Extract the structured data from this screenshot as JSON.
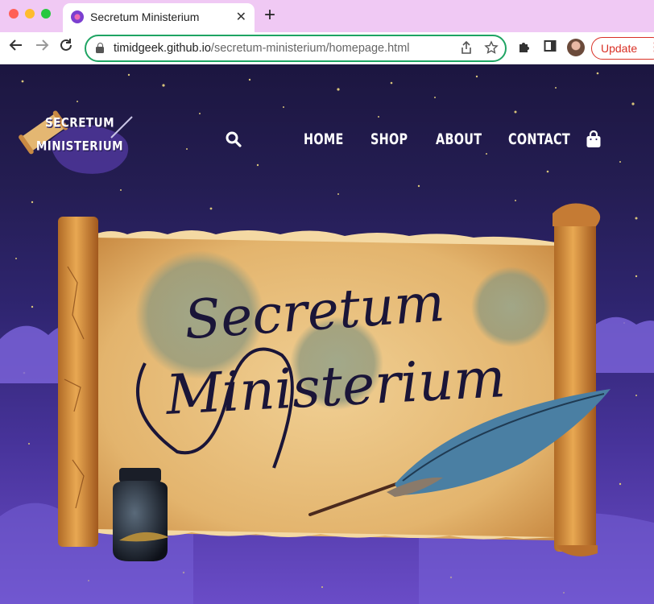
{
  "browser": {
    "tab_title": "Secretum Ministerium",
    "tab_close": "✕",
    "new_tab": "+",
    "url_domain": "timidgeek.github.io",
    "url_path": "/secretum-ministerium/homepage.html",
    "update_label": "Update",
    "update_menu": "⋮"
  },
  "site": {
    "logo_line1": "SECRETUM",
    "logo_line2": "MINISTERIUM",
    "nav": [
      "HOME",
      "SHOP",
      "ABOUT",
      "CONTACT"
    ],
    "hero_line1": "Secretum",
    "hero_line2": "Ministerium"
  },
  "colors": {
    "tabbar": "#f0c9f4",
    "omnibox_border": "#1fa463",
    "update": "#d93025",
    "sky_top": "#1c1640",
    "sky_bottom": "#6a4cc7",
    "parchment": "#e3b46d",
    "ink": "#1a1538"
  },
  "icons": {
    "search": "search-icon",
    "bag": "shopping-bag-icon",
    "back": "back-arrow-icon",
    "forward": "forward-arrow-icon",
    "reload": "reload-icon",
    "lock": "lock-icon",
    "share": "share-icon",
    "star": "bookmark-star-icon",
    "extensions": "puzzle-icon",
    "sidepanel": "side-panel-icon"
  }
}
